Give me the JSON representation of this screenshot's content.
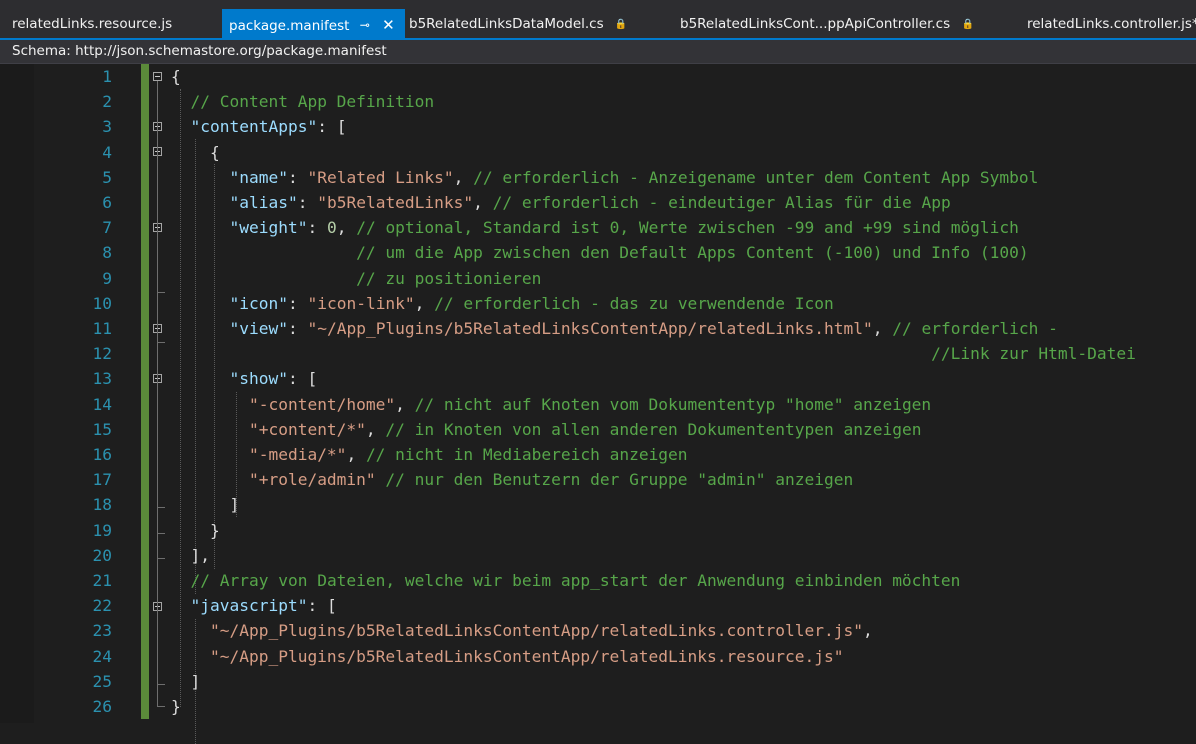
{
  "tabs": [
    {
      "label": "relatedLinks.resource.js",
      "active": false,
      "icon": ""
    },
    {
      "label": "package.manifest",
      "active": true,
      "icon": "pin-icon"
    },
    {
      "label": "b5RelatedLinksDataModel.cs",
      "active": false,
      "icon": "lock-icon"
    },
    {
      "label": "b5RelatedLinksCont...ppApiController.cs",
      "active": false,
      "icon": "lock-icon"
    },
    {
      "label": "relatedLinks.controller.js*",
      "active": false,
      "icon": ""
    }
  ],
  "tab_glyphs": {
    "pin": "⊸",
    "close": "✕",
    "lock": "🔒"
  },
  "schema": {
    "label": "Schema:",
    "value": "http://json.schemastore.org/package.manifest"
  },
  "colors": {
    "accent": "#007acc",
    "key": "#9cdcfe",
    "string": "#d69d85",
    "comment": "#57a64a",
    "number": "#b5cea8",
    "line_number": "#2b91af",
    "change_bar": "#5b8a3a"
  },
  "code": {
    "lines": [
      {
        "num": "1",
        "tokens": [
          {
            "t": "{",
            "c": "p"
          }
        ]
      },
      {
        "num": "2",
        "tokens": [
          {
            "t": "  ",
            "c": "p"
          },
          {
            "t": "// Content App Definition",
            "c": "c"
          }
        ]
      },
      {
        "num": "3",
        "tokens": [
          {
            "t": "  ",
            "c": "p"
          },
          {
            "t": "\"contentApps\"",
            "c": "k"
          },
          {
            "t": ": [",
            "c": "p"
          }
        ]
      },
      {
        "num": "4",
        "tokens": [
          {
            "t": "    {",
            "c": "p"
          }
        ]
      },
      {
        "num": "5",
        "tokens": [
          {
            "t": "      ",
            "c": "p"
          },
          {
            "t": "\"name\"",
            "c": "k"
          },
          {
            "t": ": ",
            "c": "p"
          },
          {
            "t": "\"Related Links\"",
            "c": "s"
          },
          {
            "t": ", ",
            "c": "p"
          },
          {
            "t": "// erforderlich - Anzeigename unter dem Content App Symbol",
            "c": "c"
          }
        ]
      },
      {
        "num": "6",
        "tokens": [
          {
            "t": "      ",
            "c": "p"
          },
          {
            "t": "\"alias\"",
            "c": "k"
          },
          {
            "t": ": ",
            "c": "p"
          },
          {
            "t": "\"b5RelatedLinks\"",
            "c": "s"
          },
          {
            "t": ", ",
            "c": "p"
          },
          {
            "t": "// erforderlich - eindeutiger Alias für die App",
            "c": "c"
          }
        ]
      },
      {
        "num": "7",
        "tokens": [
          {
            "t": "      ",
            "c": "p"
          },
          {
            "t": "\"weight\"",
            "c": "k"
          },
          {
            "t": ": ",
            "c": "p"
          },
          {
            "t": "0",
            "c": "n"
          },
          {
            "t": ", ",
            "c": "p"
          },
          {
            "t": "// optional, Standard ist 0, Werte zwischen -99 and +99 sind möglich",
            "c": "c"
          }
        ]
      },
      {
        "num": "8",
        "tokens": [
          {
            "t": "                   ",
            "c": "p"
          },
          {
            "t": "// um die App zwischen den Default Apps Content (-100) und Info (100)",
            "c": "c"
          }
        ]
      },
      {
        "num": "9",
        "tokens": [
          {
            "t": "                   ",
            "c": "p"
          },
          {
            "t": "// zu positionieren",
            "c": "c"
          }
        ]
      },
      {
        "num": "10",
        "tokens": [
          {
            "t": "      ",
            "c": "p"
          },
          {
            "t": "\"icon\"",
            "c": "k"
          },
          {
            "t": ": ",
            "c": "p"
          },
          {
            "t": "\"icon-link\"",
            "c": "s"
          },
          {
            "t": ", ",
            "c": "p"
          },
          {
            "t": "// erforderlich - das zu verwendende Icon",
            "c": "c"
          }
        ]
      },
      {
        "num": "11",
        "tokens": [
          {
            "t": "      ",
            "c": "p"
          },
          {
            "t": "\"view\"",
            "c": "k"
          },
          {
            "t": ": ",
            "c": "p"
          },
          {
            "t": "\"~/App_Plugins/b5RelatedLinksContentApp/relatedLinks.html\"",
            "c": "s"
          },
          {
            "t": ", ",
            "c": "p"
          },
          {
            "t": "// erforderlich -",
            "c": "c"
          }
        ]
      },
      {
        "num": "12",
        "tokens": [
          {
            "t": "                                                                              ",
            "c": "p"
          },
          {
            "t": "//Link zur Html-Datei",
            "c": "c"
          }
        ]
      },
      {
        "num": "13",
        "tokens": [
          {
            "t": "      ",
            "c": "p"
          },
          {
            "t": "\"show\"",
            "c": "k"
          },
          {
            "t": ": [",
            "c": "p"
          }
        ]
      },
      {
        "num": "14",
        "tokens": [
          {
            "t": "        ",
            "c": "p"
          },
          {
            "t": "\"-content/home\"",
            "c": "s"
          },
          {
            "t": ", ",
            "c": "p"
          },
          {
            "t": "// nicht auf Knoten vom Dokumententyp \"home\" anzeigen",
            "c": "c"
          }
        ]
      },
      {
        "num": "15",
        "tokens": [
          {
            "t": "        ",
            "c": "p"
          },
          {
            "t": "\"+content/*\"",
            "c": "s"
          },
          {
            "t": ", ",
            "c": "p"
          },
          {
            "t": "// in Knoten von allen anderen Dokumententypen anzeigen",
            "c": "c"
          }
        ]
      },
      {
        "num": "16",
        "tokens": [
          {
            "t": "        ",
            "c": "p"
          },
          {
            "t": "\"-media/*\"",
            "c": "s"
          },
          {
            "t": ", ",
            "c": "p"
          },
          {
            "t": "// nicht in Mediabereich anzeigen",
            "c": "c"
          }
        ]
      },
      {
        "num": "17",
        "tokens": [
          {
            "t": "        ",
            "c": "p"
          },
          {
            "t": "\"+role/admin\"",
            "c": "s"
          },
          {
            "t": " ",
            "c": "p"
          },
          {
            "t": "// nur den Benutzern der Gruppe \"admin\" anzeigen",
            "c": "c"
          }
        ]
      },
      {
        "num": "18",
        "tokens": [
          {
            "t": "      ]",
            "c": "p"
          }
        ]
      },
      {
        "num": "19",
        "tokens": [
          {
            "t": "    }",
            "c": "p"
          }
        ]
      },
      {
        "num": "20",
        "tokens": [
          {
            "t": "  ],",
            "c": "p"
          }
        ]
      },
      {
        "num": "21",
        "tokens": [
          {
            "t": "  ",
            "c": "p"
          },
          {
            "t": "// Array von Dateien, welche wir beim app_start der Anwendung einbinden möchten",
            "c": "c"
          }
        ]
      },
      {
        "num": "22",
        "tokens": [
          {
            "t": "  ",
            "c": "p"
          },
          {
            "t": "\"javascript\"",
            "c": "k"
          },
          {
            "t": ": [",
            "c": "p"
          }
        ]
      },
      {
        "num": "23",
        "tokens": [
          {
            "t": "    ",
            "c": "p"
          },
          {
            "t": "\"~/App_Plugins/b5RelatedLinksContentApp/relatedLinks.controller.js\"",
            "c": "s"
          },
          {
            "t": ",",
            "c": "p"
          }
        ]
      },
      {
        "num": "24",
        "tokens": [
          {
            "t": "    ",
            "c": "p"
          },
          {
            "t": "\"~/App_Plugins/b5RelatedLinksContentApp/relatedLinks.resource.js\"",
            "c": "s"
          }
        ]
      },
      {
        "num": "25",
        "tokens": [
          {
            "t": "  ]",
            "c": "p"
          }
        ]
      },
      {
        "num": "26",
        "tokens": [
          {
            "t": "}",
            "c": "p"
          }
        ]
      }
    ]
  }
}
